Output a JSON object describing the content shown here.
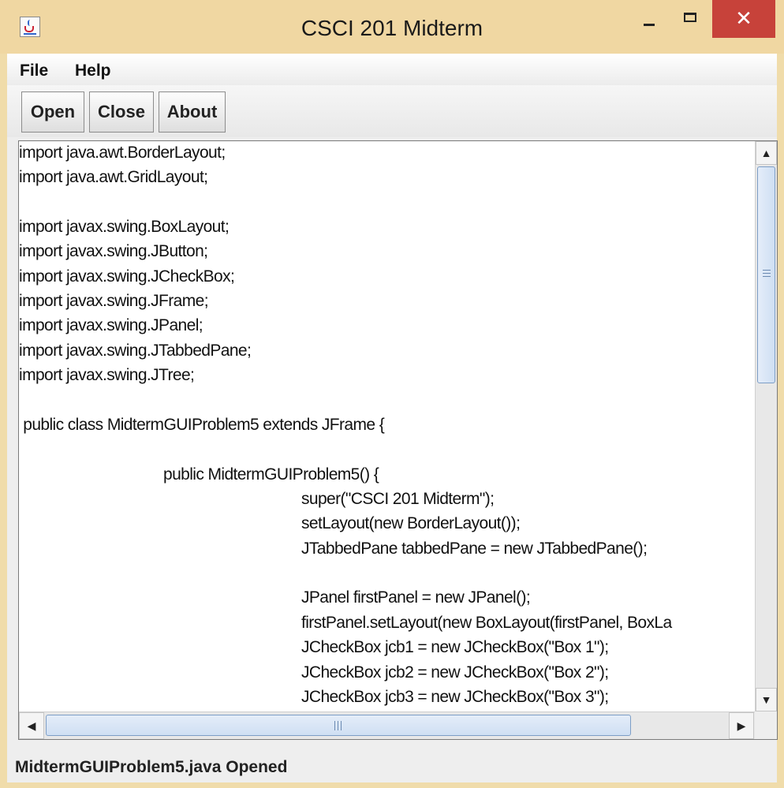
{
  "window": {
    "title": "CSCI 201 Midterm",
    "close_glyph": "✕"
  },
  "menubar": {
    "items": [
      "File",
      "Help"
    ]
  },
  "toolbar": {
    "buttons": [
      "Open",
      "Close",
      "About"
    ]
  },
  "editor": {
    "lines": [
      "import java.awt.BorderLayout;",
      "import java.awt.GridLayout;",
      "",
      "import javax.swing.BoxLayout;",
      "import javax.swing.JButton;",
      "import javax.swing.JCheckBox;",
      "import javax.swing.JFrame;",
      "import javax.swing.JPanel;",
      "import javax.swing.JTabbedPane;",
      "import javax.swing.JTree;",
      "",
      " public class MidtermGUIProblem5 extends JFrame {",
      "",
      "public MidtermGUIProblem5() {",
      "super(\"CSCI 201 Midterm\");",
      "setLayout(new BorderLayout());",
      "JTabbedPane tabbedPane = new JTabbedPane();",
      "",
      "JPanel firstPanel = new JPanel();",
      "firstPanel.setLayout(new BoxLayout(firstPanel, BoxLa",
      "JCheckBox jcb1 = new JCheckBox(\"Box 1\");",
      "JCheckBox jcb2 = new JCheckBox(\"Box 2\");",
      "JCheckBox jcb3 = new JCheckBox(\"Box 3\");"
    ]
  },
  "scrollbars": {
    "up_glyph": "▲",
    "down_glyph": "▼",
    "left_glyph": "◀",
    "right_glyph": "▶"
  },
  "status": {
    "text": "MidtermGUIProblem5.java Opened"
  }
}
